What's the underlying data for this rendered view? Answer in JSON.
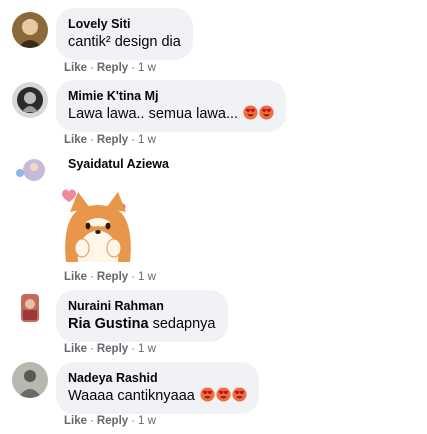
{
  "comments": [
    {
      "author": "Lovely Siti",
      "text": "cantik² design dia",
      "like": "Like",
      "reply": "Reply",
      "time": "1 w"
    },
    {
      "author": "Mimie K'tina Mj",
      "text": "Lawa lawa.. semua lawa...",
      "emojis": [
        "heart-eyes-emoji",
        "heart-eyes-emoji"
      ],
      "like": "Like",
      "reply": "Reply",
      "time": "1 w"
    },
    {
      "author": "Syaidatul Aziewa",
      "sticker": "shiba-dog-sticker",
      "like": "Like",
      "reply": "Reply",
      "time": "1 w"
    },
    {
      "author": "Nuraini Rahman",
      "tag": "Ria Gustina",
      "text": " sedapnya",
      "like": "Like",
      "reply": "Reply",
      "time": "1 w"
    },
    {
      "author": "Nadeya Rashid",
      "text": "Waaaa cantiknyaaa",
      "emojis": [
        "heart-eyes-emoji",
        "heart-eyes-emoji",
        "heart-eyes-emoji"
      ],
      "like": "Like",
      "reply": "Reply",
      "time": "1 w"
    }
  ],
  "colors": {
    "bubble": "#f0f2f5",
    "meta_text": "#65676b",
    "emoji_face": "#e8563a",
    "emoji_heart": "#e0245e"
  }
}
